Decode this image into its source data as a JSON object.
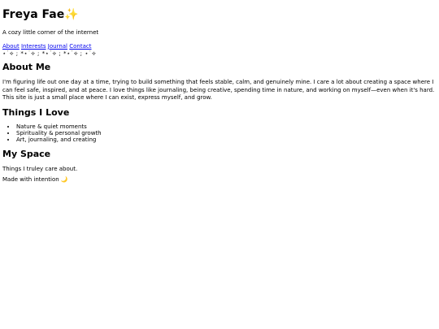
{
  "header": {
    "site_title": "Freya Fae",
    "title_emoji": "✨",
    "tagline": "A cozy little corner of the internet"
  },
  "nav": {
    "links": [
      {
        "label": "About"
      },
      {
        "label": "Interests"
      },
      {
        "label": "Journal"
      },
      {
        "label": "Contact"
      }
    ],
    "divider": "⋆˙⟡ ; *⋆˙⟡ ; *⋆˙⟡ ; *⋆˙⟡ ; ⋆˙⟡"
  },
  "about": {
    "heading": "About Me",
    "text": "I'm figuring life out one day at a time, trying to build something that feels stable, calm, and genuinely mine. I care a lot about creating a space where I can feel safe, inspired, and at peace. I love things like journaling, being creative, spending time in nature, and working on myself—even when it's hard. This site is just a small place where I can exist, express myself, and grow."
  },
  "things": {
    "heading": "Things I Love",
    "items": [
      "Nature & quiet moments",
      "Spirituality & personal growth",
      "Art, journaling, and creating"
    ]
  },
  "space": {
    "heading": "My Space",
    "text": "Things I truley care about."
  },
  "footer": {
    "text": "Made with intention",
    "emoji": "🌙"
  }
}
